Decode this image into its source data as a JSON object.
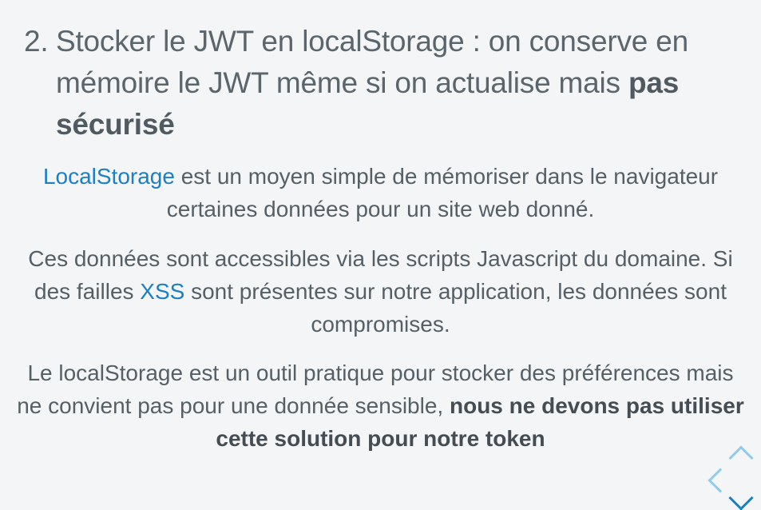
{
  "slide": {
    "heading": {
      "number": "2.",
      "text_plain": "Stocker le JWT en localStorage : on conserve en mémoire le JWT même si on actualise mais",
      "text_strong": "pas sécurisé"
    },
    "paragraph1": {
      "link": "LocalStorage",
      "rest": " est un moyen simple de mémoriser dans le navigateur certaines données pour un site web donné."
    },
    "paragraph2": {
      "before": "Ces données sont accessibles via les scripts Javascript du domaine. Si des failles ",
      "link": "XSS",
      "after": " sont présentes sur notre application, les données sont compromises."
    },
    "paragraph3": {
      "plain": "Le localStorage est un outil pratique pour stocker des préférences mais ne convient pas pour une donnée sensible,",
      "strong": "nous ne devons pas utiliser cette solution pour notre token"
    }
  },
  "navigation": {
    "up_icon": "chevron-up-icon",
    "left_icon": "chevron-left-icon",
    "down_icon": "chevron-down-icon",
    "colors": {
      "inactive": "#8fcbee",
      "active": "#1b7fc4"
    }
  }
}
